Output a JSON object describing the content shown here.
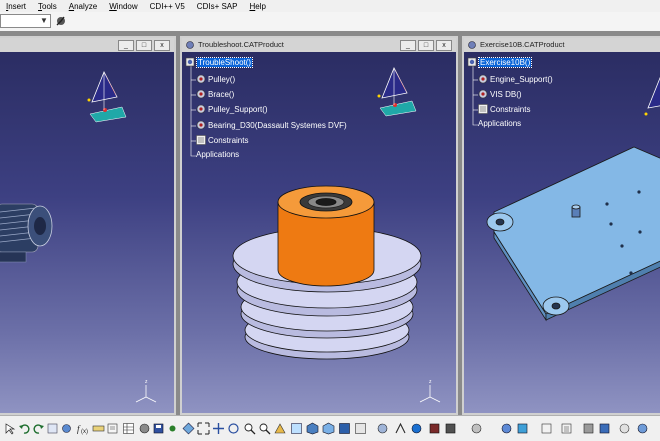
{
  "menu": {
    "items": [
      {
        "label": "Insert",
        "ul": "I"
      },
      {
        "label": "Tools",
        "ul": "T"
      },
      {
        "label": "Analyze",
        "ul": "A"
      },
      {
        "label": "Window",
        "ul": "W"
      },
      {
        "label": "CDI++ V5",
        "ul": ""
      },
      {
        "label": "CDIs+ SAP",
        "ul": ""
      },
      {
        "label": "Help",
        "ul": "H"
      }
    ]
  },
  "windows": [
    {
      "title": "",
      "controls": [
        "_",
        "□",
        "x"
      ]
    },
    {
      "title": "Troubleshoot.CATProduct",
      "controls": [
        "_",
        "□",
        "x"
      ],
      "tree": [
        "TroubleShoot()",
        "Pulley()",
        "Brace()",
        "Pulley_Support()",
        "Bearing_D30(Dassault Systemes DVF)",
        "Constraints",
        "Applications"
      ]
    },
    {
      "title": "Exercise10B.CATProduct",
      "controls": [
        "_",
        "□",
        "x"
      ],
      "tree": [
        "Exercise10B()",
        "Engine_Support()",
        "VIS DB()",
        "Constraints",
        "Applications"
      ]
    }
  ],
  "colors": {
    "accent_selection": "#0a64d8",
    "sleeve_orange": "#ee7a12",
    "pulley_lavender": "#d4d6f2",
    "plate_blue": "#84b8e6"
  },
  "icons": {
    "product": "product-gear-icon",
    "compass": "compass-icon",
    "axis": "xyz-axis-icon"
  }
}
